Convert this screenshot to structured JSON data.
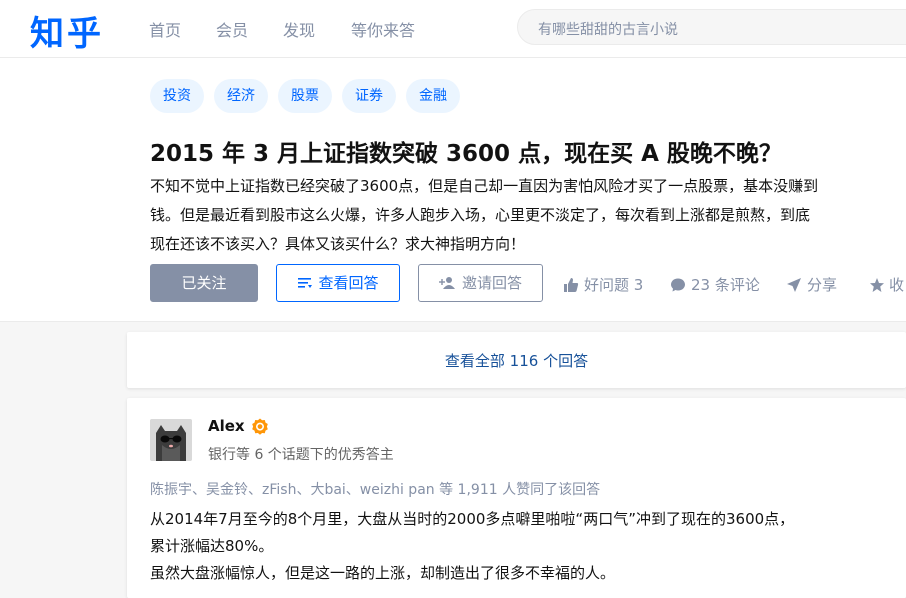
{
  "header": {
    "logo": "知乎",
    "nav": [
      "首页",
      "会员",
      "发现",
      "等你来答"
    ],
    "search_placeholder": "有哪些甜甜的古言小说"
  },
  "question": {
    "tags": [
      "投资",
      "经济",
      "股票",
      "证券",
      "金融"
    ],
    "title": "2015 年 3 月上证指数突破 3600 点，现在买 A 股晚不晚？",
    "description_lines": [
      "不知不觉中上证指数已经突破了3600点，但是自己却一直因为害怕风险才买了一点股票，基本没赚到",
      "钱。但是最近看到股市这么火爆，许多人跑步入场，心里更不淡定了，每次看到上涨都是煎熬，到底",
      "现在还该不该买入？具体又该买什么？求大神指明方向！"
    ],
    "buttons": {
      "followed": "已关注",
      "view_answers": "查看回答",
      "invite": "邀请回答"
    },
    "actions": {
      "good_question": "好问题 3",
      "comments": "23 条评论",
      "share": "分享",
      "more": "收"
    }
  },
  "view_all": "查看全部 116 个回答",
  "answer": {
    "author_name": "Alex",
    "author_bio": "银行等 6 个话题下的优秀答主",
    "voters": "陈振宇、吴金铃、zFish、大bai、weizhi pan 等 1,911 人赞同了该回答",
    "content_lines": [
      "从2014年7月至今的8个月里，大盘从当时的2000多点噼里啪啦“两口气”冲到了现在的3600点，",
      "累计涨幅达80%。",
      "虽然大盘涨幅惊人，但是这一路的上涨，却制造出了很多不幸福的人。"
    ]
  },
  "colors": {
    "brand": "#0066ff",
    "tag_bg": "#ebf5ff",
    "muted": "#8590a6",
    "link": "#175199"
  }
}
